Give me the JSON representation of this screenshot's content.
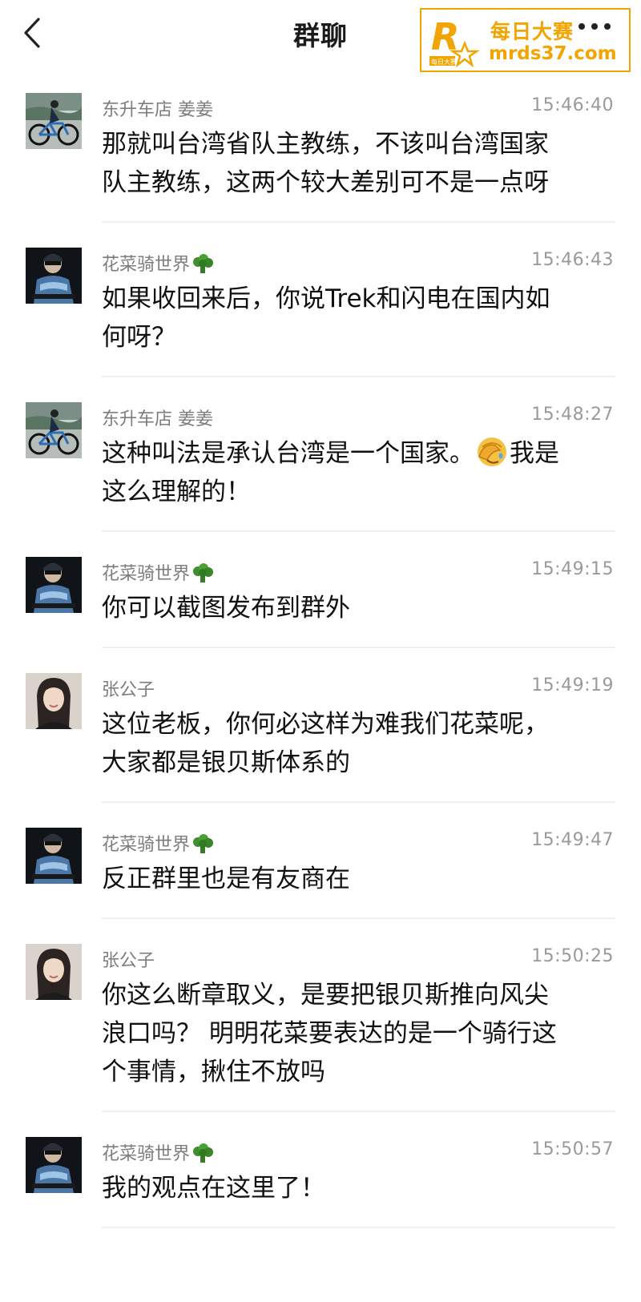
{
  "header": {
    "back_icon": "chevron-left-icon",
    "title": "群聊",
    "more_icon": "more-horizontal-icon"
  },
  "watermark": {
    "brand": "每日大赛",
    "url": "mrds37.com",
    "logo_text": "每日大赛",
    "color": "#f2a400"
  },
  "messages": [
    {
      "sender": "东升车店 姜姜",
      "time": "15:46:40",
      "avatar": "cyclist-avatar",
      "lines": [
        "那就叫台湾省队主教练，不该叫台湾国家",
        "队主教练，这两个较大差别可不是一点呀"
      ]
    },
    {
      "sender": "花菜骑世界",
      "sender_icon": "broccoli-icon",
      "time": "15:46:43",
      "avatar": "rider-avatar",
      "lines": [
        "如果收回来后，你说Trek和闪电在国内如",
        "何呀？"
      ]
    },
    {
      "sender": "东升车店 姜姜",
      "time": "15:48:27",
      "avatar": "cyclist-avatar",
      "line1_before": "这种叫法是承认台湾是一个国家。",
      "line1_after": "我是",
      "line1_icon": "facepalm-emoji-icon",
      "line2": "这么理解的！"
    },
    {
      "sender": "花菜骑世界",
      "sender_icon": "broccoli-icon",
      "time": "15:49:15",
      "avatar": "rider-avatar",
      "lines": [
        "你可以截图发布到群外"
      ]
    },
    {
      "sender": "张公子",
      "time": "15:49:19",
      "avatar": "woman-avatar",
      "lines": [
        "这位老板，你何必这样为难我们花菜呢，",
        "大家都是银贝斯体系的"
      ]
    },
    {
      "sender": "花菜骑世界",
      "sender_icon": "broccoli-icon",
      "time": "15:49:47",
      "avatar": "rider-avatar",
      "lines": [
        "反正群里也是有友商在"
      ]
    },
    {
      "sender": "张公子",
      "time": "15:50:25",
      "avatar": "woman-avatar",
      "lines": [
        "你这么断章取义，是要把银贝斯推向风尖",
        "浪口吗？ 明明花菜要表达的是一个骑行这",
        "个事情，揪住不放吗"
      ]
    },
    {
      "sender": "花菜骑世界",
      "sender_icon": "broccoli-icon",
      "time": "15:50:57",
      "avatar": "rider-avatar",
      "lines": [
        "我的观点在这里了！"
      ]
    }
  ]
}
